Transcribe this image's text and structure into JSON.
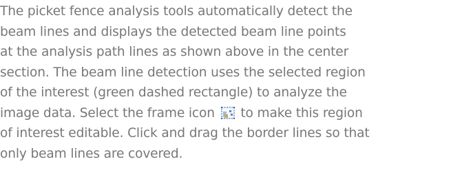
{
  "paragraph": {
    "line1": "The picket fence analysis tools automatically detect the",
    "line2": "beam lines and displays the detected beam line points",
    "line3": "at the analysis path lines as shown above in the center",
    "line4": "section. The beam line detection uses the selected region",
    "line5": "of the interest (green dashed rectangle) to analyze the",
    "line6_before_icon": "image data. Select the frame icon",
    "line6_after_icon": "to make this region",
    "line7": "of interest editable. Click and drag the border lines so that",
    "line8": "only beam lines are covered."
  },
  "icons": {
    "frame": "frame-icon"
  },
  "colors": {
    "text": "#777777"
  }
}
